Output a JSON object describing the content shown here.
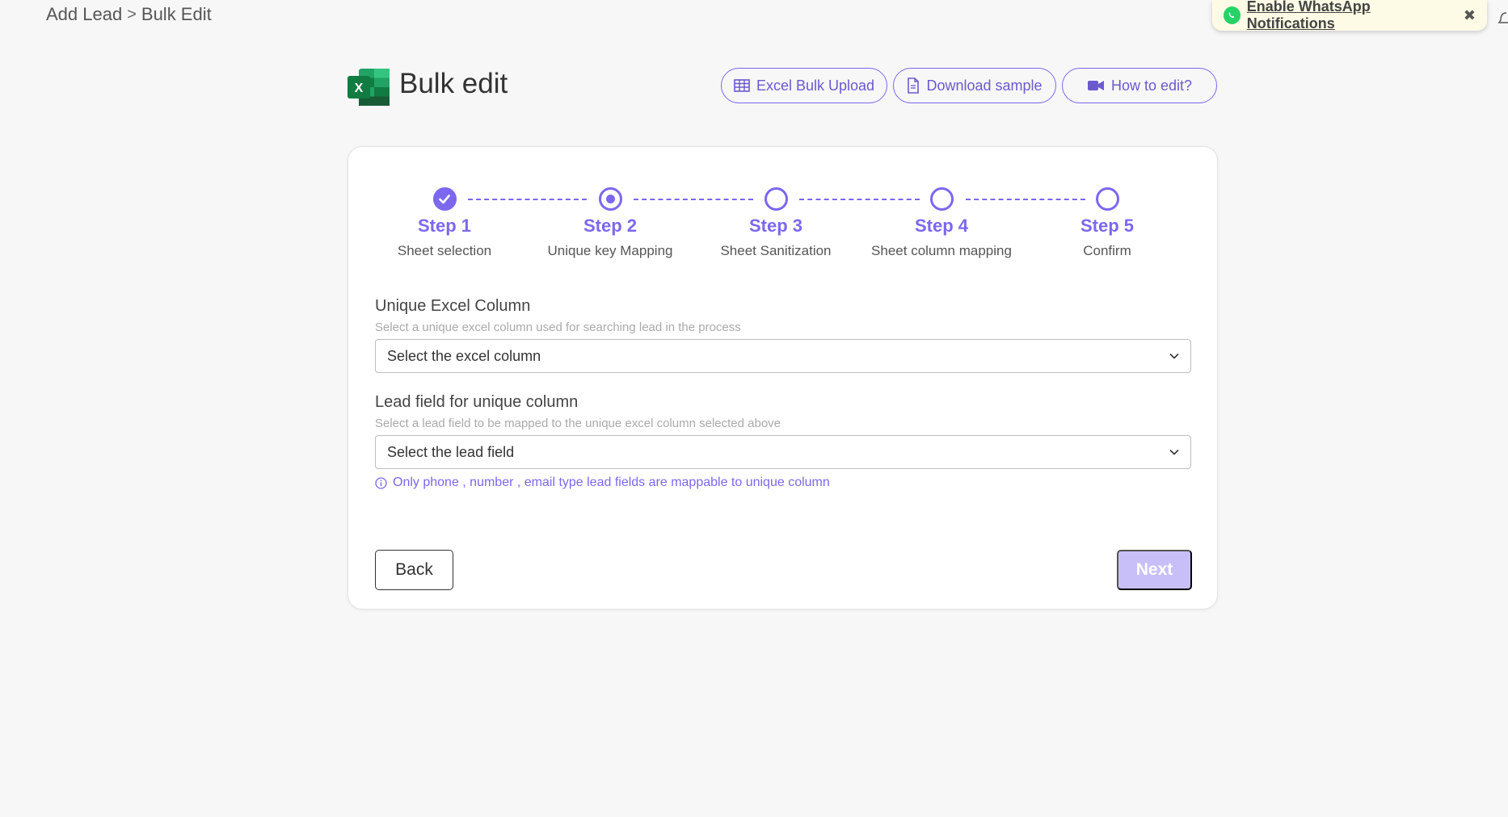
{
  "breadcrumb": {
    "parent": "Add Lead",
    "separator": ">",
    "current": "Bulk Edit"
  },
  "whatsapp": {
    "text": "Enable WhatsApp Notifications",
    "close": "✖"
  },
  "header": {
    "title": "Bulk edit",
    "buttons": {
      "upload": "Excel Bulk Upload",
      "sample": "Download sample",
      "howto": "How to edit?"
    }
  },
  "stepper": [
    {
      "num": "Step 1",
      "label": "Sheet selection",
      "state": "done"
    },
    {
      "num": "Step 2",
      "label": "Unique key Mapping",
      "state": "current"
    },
    {
      "num": "Step 3",
      "label": "Sheet Sanitization",
      "state": "pending"
    },
    {
      "num": "Step 4",
      "label": "Sheet column mapping",
      "state": "pending"
    },
    {
      "num": "Step 5",
      "label": "Confirm",
      "state": "pending"
    }
  ],
  "unique_column": {
    "title": "Unique Excel Column",
    "subtitle": "Select a unique excel column used for searching lead in the process",
    "value": "Select the excel column"
  },
  "lead_field": {
    "title": "Lead field for unique column",
    "subtitle": "Select a lead field to be mapped to the unique excel column selected above",
    "value": "Select the lead field",
    "note": "Only phone , number , email type lead fields are mappable to unique column"
  },
  "actions": {
    "back": "Back",
    "next": "Next"
  },
  "colors": {
    "accent": "#7b68ee",
    "next_disabled": "#c8bff9",
    "whatsapp": "#25d366",
    "excel": "#1d6f42"
  }
}
